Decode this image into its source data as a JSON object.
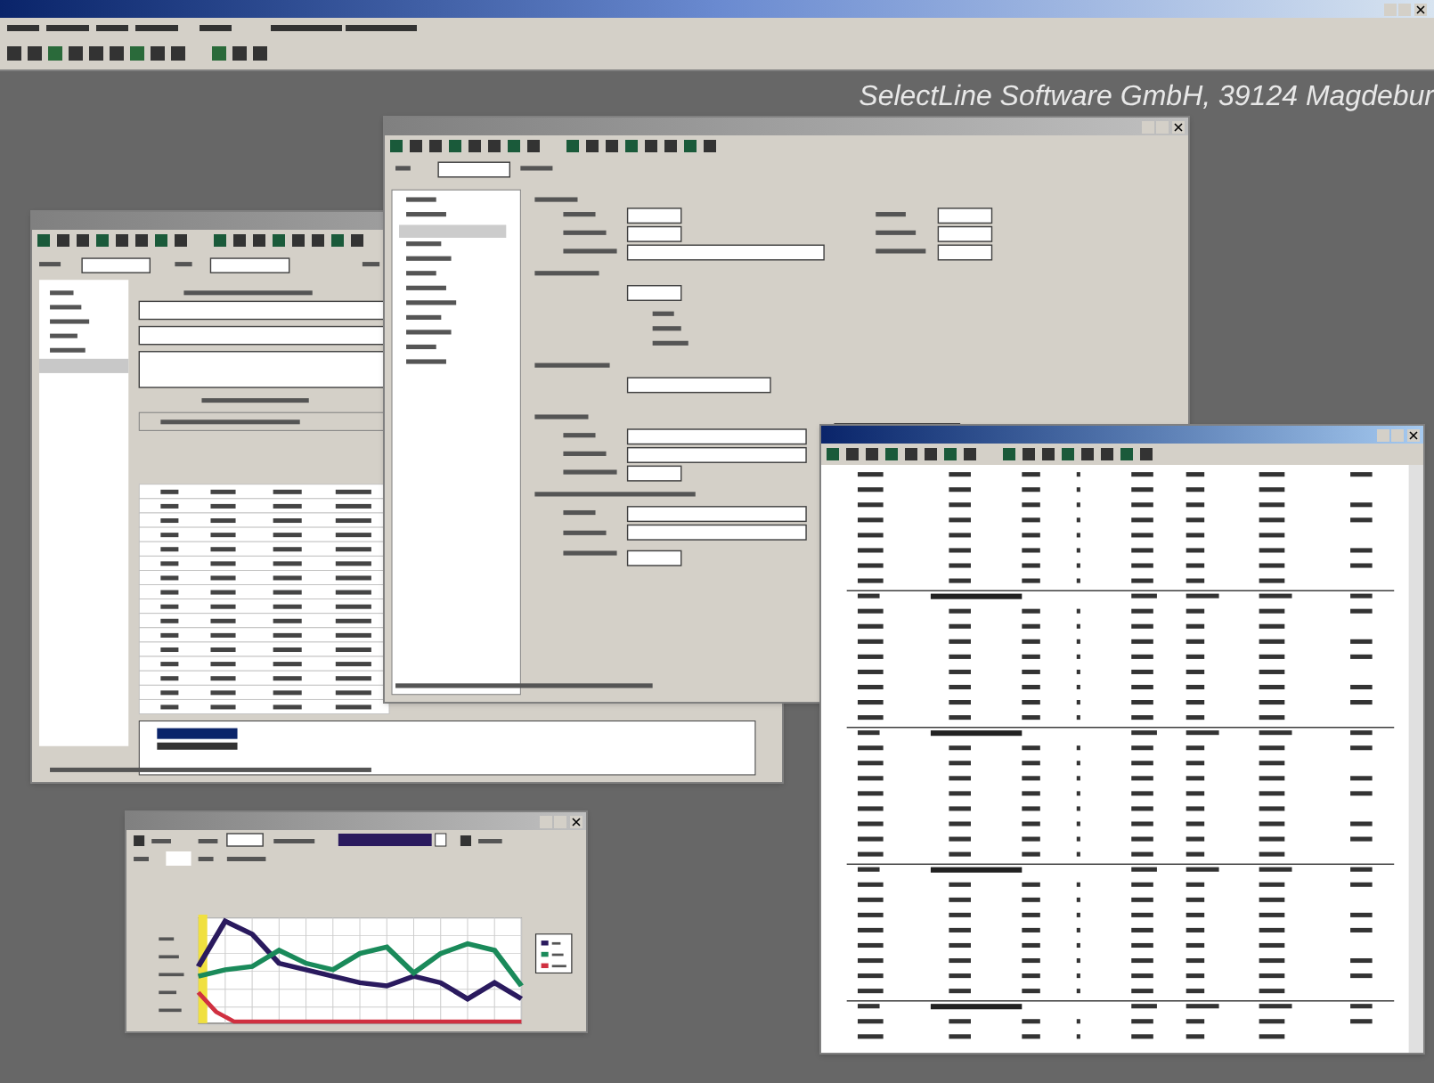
{
  "app": {
    "active": true
  },
  "desktop": {
    "banner": "SelectLine Software GmbH, 39124 Magdebur"
  },
  "windows": [
    {
      "kind": "order",
      "active": false
    },
    {
      "kind": "article",
      "active": false
    },
    {
      "kind": "report",
      "active": true
    },
    {
      "kind": "chart",
      "active": false
    }
  ]
}
